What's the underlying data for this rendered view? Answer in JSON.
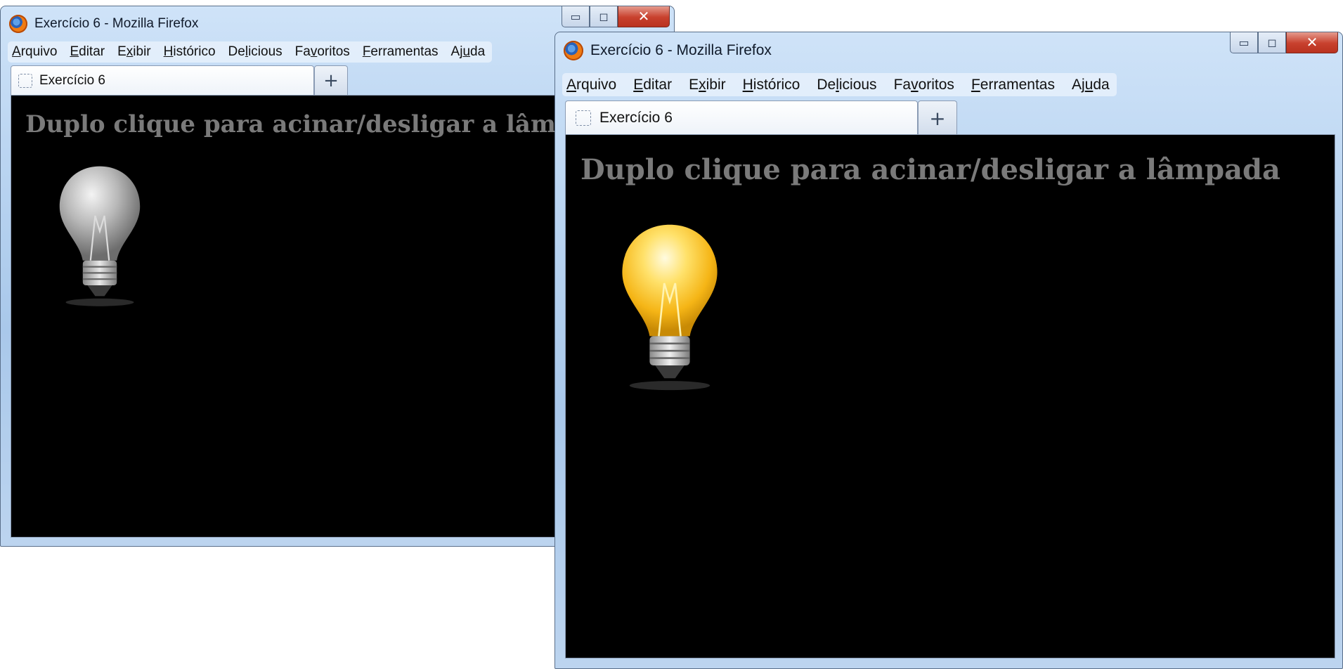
{
  "windows": [
    {
      "title": "Exercício 6 - Mozilla Firefox",
      "menu": [
        {
          "acc": "A",
          "rest": "rquivo"
        },
        {
          "acc": "E",
          "rest": "ditar"
        },
        {
          "pre": "E",
          "acc": "x",
          "rest": "ibir"
        },
        {
          "acc": "H",
          "rest": "istórico"
        },
        {
          "pre": "De",
          "acc": "l",
          "rest": "icious"
        },
        {
          "pre": "Fa",
          "acc": "v",
          "rest": "oritos"
        },
        {
          "acc": "F",
          "rest": "erramentas"
        },
        {
          "pre": "Aj",
          "acc": "u",
          "rest": "da"
        }
      ],
      "tab_label": "Exercício 6",
      "newtab_symbol": "+",
      "heading": "Duplo clique para acinar/desligar a lâmpada",
      "bulb_state": "off",
      "caption_buttons": {
        "minimize": "▭",
        "maximize": "◻",
        "close": "✕"
      }
    },
    {
      "title": "Exercício 6 - Mozilla Firefox",
      "menu": [
        {
          "acc": "A",
          "rest": "rquivo"
        },
        {
          "acc": "E",
          "rest": "ditar"
        },
        {
          "pre": "E",
          "acc": "x",
          "rest": "ibir"
        },
        {
          "acc": "H",
          "rest": "istórico"
        },
        {
          "pre": "De",
          "acc": "l",
          "rest": "icious"
        },
        {
          "pre": "Fa",
          "acc": "v",
          "rest": "oritos"
        },
        {
          "acc": "F",
          "rest": "erramentas"
        },
        {
          "pre": "Aj",
          "acc": "u",
          "rest": "da"
        }
      ],
      "tab_label": "Exercício 6",
      "newtab_symbol": "+",
      "heading": "Duplo clique para acinar/desligar a lâmpada",
      "bulb_state": "on",
      "caption_buttons": {
        "minimize": "▭",
        "maximize": "◻",
        "close": "✕"
      }
    }
  ],
  "colors": {
    "page_background": "#000000",
    "heading_text": "#7a7a7a",
    "bulb_on": "#f5c21b",
    "bulb_off": "#c9c9c9"
  }
}
